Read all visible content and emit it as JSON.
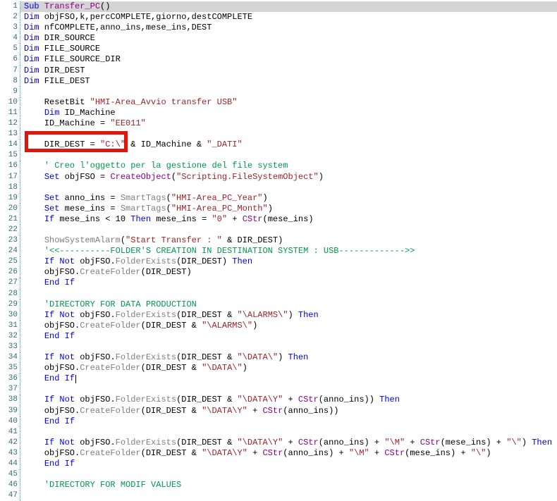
{
  "editor": {
    "language": "VBScript",
    "selected_line": 1,
    "caret_line": 36,
    "colors": {
      "keyword": "#0000e0",
      "string": "#9c2328",
      "comment": "#00994c",
      "function-gray": "#7f7f7f",
      "library-purple": "#8b008b",
      "text": "#000000",
      "line-number": "#2f6e6e",
      "gutter-border": "#3aa0a0",
      "selection-bg": "#d4d4d4",
      "annotation-red": "#e0160e"
    },
    "lines": [
      {
        "n": 1,
        "selected": true,
        "tokens": [
          [
            "kw",
            "Sub"
          ],
          [
            "pl",
            " "
          ],
          [
            "ob",
            "Transfer_PC"
          ],
          [
            "pl",
            "()"
          ]
        ]
      },
      {
        "n": 2,
        "tokens": [
          [
            "kw",
            "Dim"
          ],
          [
            "pl",
            " objFSO,k,percCOMPLETE,giorno,destCOMPLETE"
          ]
        ]
      },
      {
        "n": 3,
        "tokens": [
          [
            "kw",
            "Dim"
          ],
          [
            "pl",
            " nfCOMPLETE,anno_ins,mese_ins,DEST"
          ]
        ]
      },
      {
        "n": 4,
        "tokens": [
          [
            "kw",
            "Dim"
          ],
          [
            "pl",
            " DIR_SOURCE"
          ]
        ]
      },
      {
        "n": 5,
        "tokens": [
          [
            "kw",
            "Dim"
          ],
          [
            "pl",
            " FILE_SOURCE"
          ]
        ]
      },
      {
        "n": 6,
        "tokens": [
          [
            "kw",
            "Dim"
          ],
          [
            "pl",
            " FILE_SOURCE_DIR"
          ]
        ]
      },
      {
        "n": 7,
        "tokens": [
          [
            "kw",
            "Dim"
          ],
          [
            "pl",
            " DIR_DEST"
          ]
        ]
      },
      {
        "n": 8,
        "tokens": [
          [
            "kw",
            "Dim"
          ],
          [
            "pl",
            " FILE_DEST"
          ]
        ]
      },
      {
        "n": 9,
        "tokens": []
      },
      {
        "n": 10,
        "tokens": [
          [
            "pl",
            "    ResetBit "
          ],
          [
            "st",
            "\"HMI-Area_Avvio transfer USB\""
          ]
        ]
      },
      {
        "n": 11,
        "tokens": [
          [
            "pl",
            "    "
          ],
          [
            "kw",
            "Dim"
          ],
          [
            "pl",
            " ID_Machine"
          ]
        ]
      },
      {
        "n": 12,
        "tokens": [
          [
            "pl",
            "    ID_Machine = "
          ],
          [
            "st",
            "\"EE011\""
          ]
        ]
      },
      {
        "n": 13,
        "tokens": []
      },
      {
        "n": 14,
        "tokens": [
          [
            "pl",
            "    DIR_DEST = "
          ],
          [
            "st",
            "\"C:\\\""
          ],
          [
            "pl",
            " & ID_Machine & "
          ],
          [
            "st",
            "\"_DATI\""
          ]
        ]
      },
      {
        "n": 15,
        "tokens": []
      },
      {
        "n": 16,
        "tokens": [
          [
            "cm",
            "    ' Creo l'oggetto per la gestione del file system"
          ]
        ]
      },
      {
        "n": 17,
        "tokens": [
          [
            "pl",
            "    "
          ],
          [
            "kw",
            "Set"
          ],
          [
            "pl",
            " objFSO = "
          ],
          [
            "ob",
            "CreateObject"
          ],
          [
            "pl",
            "("
          ],
          [
            "st",
            "\"Scripting.FileSystemObject\""
          ],
          [
            "pl",
            ")"
          ]
        ]
      },
      {
        "n": 18,
        "tokens": []
      },
      {
        "n": 19,
        "tokens": [
          [
            "pl",
            "    "
          ],
          [
            "kw",
            "Set"
          ],
          [
            "pl",
            " anno_ins = "
          ],
          [
            "fn",
            "SmartTags"
          ],
          [
            "pl",
            "("
          ],
          [
            "st",
            "\"HMI-Area_PC_Year\""
          ],
          [
            "pl",
            ")"
          ]
        ]
      },
      {
        "n": 20,
        "tokens": [
          [
            "pl",
            "    "
          ],
          [
            "kw",
            "Set"
          ],
          [
            "pl",
            " mese_ins = "
          ],
          [
            "fn",
            "SmartTags"
          ],
          [
            "pl",
            "("
          ],
          [
            "st",
            "\"HMI-Area_PC_Month\""
          ],
          [
            "pl",
            ")"
          ]
        ]
      },
      {
        "n": 21,
        "tokens": [
          [
            "pl",
            "    "
          ],
          [
            "kw",
            "If"
          ],
          [
            "pl",
            " mese_ins < 10 "
          ],
          [
            "kw",
            "Then"
          ],
          [
            "pl",
            " mese_ins = "
          ],
          [
            "st",
            "\"0\""
          ],
          [
            "pl",
            " + "
          ],
          [
            "ob",
            "CStr"
          ],
          [
            "pl",
            "(mese_ins)"
          ]
        ]
      },
      {
        "n": 22,
        "tokens": []
      },
      {
        "n": 23,
        "tokens": [
          [
            "pl",
            "    "
          ],
          [
            "fn",
            "ShowSystemAlarm"
          ],
          [
            "pl",
            "("
          ],
          [
            "st",
            "\"Start Transfer : \""
          ],
          [
            "pl",
            " & DIR_DEST)"
          ]
        ]
      },
      {
        "n": 24,
        "tokens": [
          [
            "cm",
            "    '<<----------FOLDER'S CREATION IN DESTINATION SYSTEM : USB------------->>"
          ]
        ]
      },
      {
        "n": 25,
        "tokens": [
          [
            "pl",
            "    "
          ],
          [
            "kw",
            "If"
          ],
          [
            "pl",
            " "
          ],
          [
            "kw",
            "Not"
          ],
          [
            "pl",
            " objFSO."
          ],
          [
            "fn",
            "FolderExists"
          ],
          [
            "pl",
            "(DIR_DEST) "
          ],
          [
            "kw",
            "Then"
          ]
        ]
      },
      {
        "n": 26,
        "tokens": [
          [
            "pl",
            "    objFSO."
          ],
          [
            "fn",
            "CreateFolder"
          ],
          [
            "pl",
            "(DIR_DEST)"
          ]
        ]
      },
      {
        "n": 27,
        "tokens": [
          [
            "pl",
            "    "
          ],
          [
            "kw",
            "End If"
          ]
        ]
      },
      {
        "n": 28,
        "tokens": []
      },
      {
        "n": 29,
        "tokens": [
          [
            "cm",
            "    'DIRECTORY FOR DATA PRODUCTION"
          ]
        ]
      },
      {
        "n": 30,
        "tokens": [
          [
            "pl",
            "    "
          ],
          [
            "kw",
            "If"
          ],
          [
            "pl",
            " "
          ],
          [
            "kw",
            "Not"
          ],
          [
            "pl",
            " objFSO."
          ],
          [
            "fn",
            "FolderExists"
          ],
          [
            "pl",
            "(DIR_DEST & "
          ],
          [
            "st",
            "\"\\ALARMS\\\""
          ],
          [
            "pl",
            ") "
          ],
          [
            "kw",
            "Then"
          ]
        ]
      },
      {
        "n": 31,
        "tokens": [
          [
            "pl",
            "    objFSO."
          ],
          [
            "fn",
            "CreateFolder"
          ],
          [
            "pl",
            "(DIR_DEST & "
          ],
          [
            "st",
            "\"\\ALARMS\\\""
          ],
          [
            "pl",
            ")"
          ]
        ]
      },
      {
        "n": 32,
        "tokens": [
          [
            "pl",
            "    "
          ],
          [
            "kw",
            "End If"
          ]
        ]
      },
      {
        "n": 33,
        "tokens": []
      },
      {
        "n": 34,
        "tokens": [
          [
            "pl",
            "    "
          ],
          [
            "kw",
            "If"
          ],
          [
            "pl",
            " "
          ],
          [
            "kw",
            "Not"
          ],
          [
            "pl",
            " objFSO."
          ],
          [
            "fn",
            "FolderExists"
          ],
          [
            "pl",
            "(DIR_DEST & "
          ],
          [
            "st",
            "\"\\DATA\\\""
          ],
          [
            "pl",
            ") "
          ],
          [
            "kw",
            "Then"
          ]
        ]
      },
      {
        "n": 35,
        "tokens": [
          [
            "pl",
            "    objFSO."
          ],
          [
            "fn",
            "CreateFolder"
          ],
          [
            "pl",
            "(DIR_DEST & "
          ],
          [
            "st",
            "\"\\DATA\\\""
          ],
          [
            "pl",
            ")"
          ]
        ]
      },
      {
        "n": 36,
        "tokens": [
          [
            "pl",
            "    "
          ],
          [
            "kw",
            "End If"
          ],
          [
            "caret",
            ""
          ]
        ]
      },
      {
        "n": 37,
        "tokens": []
      },
      {
        "n": 38,
        "tokens": [
          [
            "pl",
            "    "
          ],
          [
            "kw",
            "If"
          ],
          [
            "pl",
            " "
          ],
          [
            "kw",
            "Not"
          ],
          [
            "pl",
            " objFSO."
          ],
          [
            "fn",
            "FolderExists"
          ],
          [
            "pl",
            "(DIR_DEST & "
          ],
          [
            "st",
            "\"\\DATA\\Y\""
          ],
          [
            "pl",
            " + "
          ],
          [
            "ob",
            "CStr"
          ],
          [
            "pl",
            "(anno_ins)) "
          ],
          [
            "kw",
            "Then"
          ]
        ]
      },
      {
        "n": 39,
        "tokens": [
          [
            "pl",
            "    objFSO."
          ],
          [
            "fn",
            "CreateFolder"
          ],
          [
            "pl",
            "(DIR_DEST & "
          ],
          [
            "st",
            "\"\\DATA\\Y\""
          ],
          [
            "pl",
            " + "
          ],
          [
            "ob",
            "CStr"
          ],
          [
            "pl",
            "(anno_ins))"
          ]
        ]
      },
      {
        "n": 40,
        "tokens": [
          [
            "pl",
            "    "
          ],
          [
            "kw",
            "End If"
          ]
        ]
      },
      {
        "n": 41,
        "tokens": []
      },
      {
        "n": 42,
        "tokens": [
          [
            "pl",
            "    "
          ],
          [
            "kw",
            "If"
          ],
          [
            "pl",
            " "
          ],
          [
            "kw",
            "Not"
          ],
          [
            "pl",
            " objFSO."
          ],
          [
            "fn",
            "FolderExists"
          ],
          [
            "pl",
            "(DIR_DEST & "
          ],
          [
            "st",
            "\"\\DATA\\Y\""
          ],
          [
            "pl",
            " + "
          ],
          [
            "ob",
            "CStr"
          ],
          [
            "pl",
            "(anno_ins) + "
          ],
          [
            "st",
            "\"\\M\""
          ],
          [
            "pl",
            " + "
          ],
          [
            "ob",
            "CStr"
          ],
          [
            "pl",
            "(mese_ins) + "
          ],
          [
            "st",
            "\"\\\""
          ],
          [
            "pl",
            ") "
          ],
          [
            "kw",
            "Then"
          ]
        ]
      },
      {
        "n": 43,
        "tokens": [
          [
            "pl",
            "    objFSO."
          ],
          [
            "fn",
            "CreateFolder"
          ],
          [
            "pl",
            "(DIR_DEST & "
          ],
          [
            "st",
            "\"\\DATA\\Y\""
          ],
          [
            "pl",
            " + "
          ],
          [
            "ob",
            "CStr"
          ],
          [
            "pl",
            "(anno_ins) + "
          ],
          [
            "st",
            "\"\\M\""
          ],
          [
            "pl",
            " + "
          ],
          [
            "ob",
            "CStr"
          ],
          [
            "pl",
            "(mese_ins) + "
          ],
          [
            "st",
            "\"\\\""
          ],
          [
            "pl",
            ")"
          ]
        ]
      },
      {
        "n": 44,
        "tokens": [
          [
            "pl",
            "    "
          ],
          [
            "kw",
            "End If"
          ]
        ]
      },
      {
        "n": 45,
        "tokens": []
      },
      {
        "n": 46,
        "tokens": [
          [
            "cm",
            "    'DIRECTORY FOR MODIF VALUES"
          ]
        ]
      },
      {
        "n": 47,
        "tokens": []
      }
    ]
  },
  "annotation": {
    "shape": "red-rectangle",
    "line": 14,
    "highlighted_text": "DIR_DEST = \"C:\\\""
  }
}
